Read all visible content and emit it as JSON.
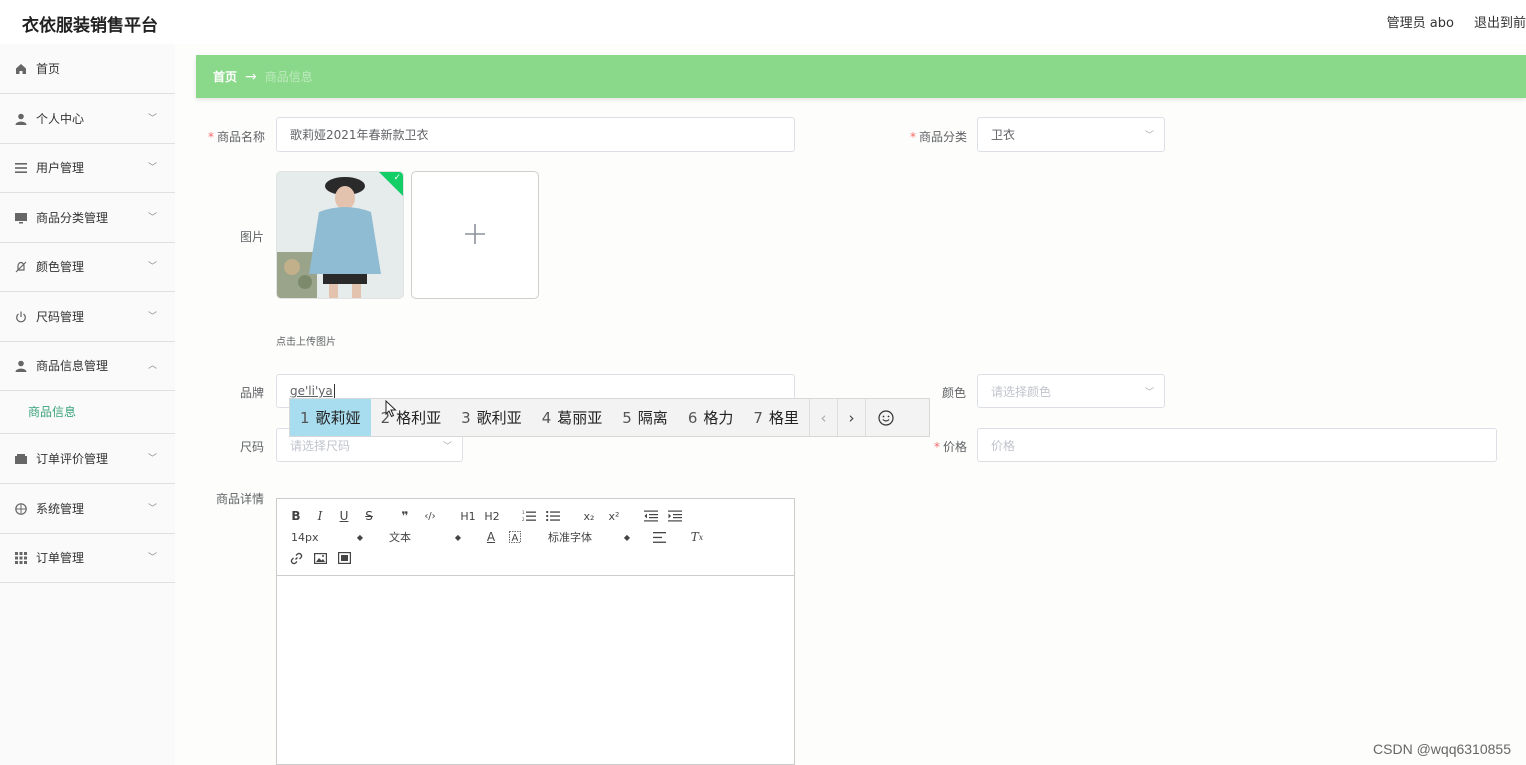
{
  "app": {
    "title": "衣依服装销售平台"
  },
  "header": {
    "user": "管理员 abo",
    "exit": "退出到前"
  },
  "sidebar": {
    "items": [
      {
        "label": "首页",
        "icon": "home-icon"
      },
      {
        "label": "个人中心",
        "icon": "user-icon"
      },
      {
        "label": "用户管理",
        "icon": "list-icon"
      },
      {
        "label": "商品分类管理",
        "icon": "monitor-icon"
      },
      {
        "label": "颜色管理",
        "icon": "bell-off-icon"
      },
      {
        "label": "尺码管理",
        "icon": "power-icon"
      },
      {
        "label": "商品信息管理",
        "icon": "user-icon"
      },
      {
        "label": "订单评价管理",
        "icon": "wallet-icon"
      },
      {
        "label": "系统管理",
        "icon": "globe-icon"
      },
      {
        "label": "订单管理",
        "icon": "grid-icon"
      }
    ],
    "active_sub": "商品信息"
  },
  "breadcrumb": {
    "home": "首页",
    "sep": "→",
    "current": "商品信息"
  },
  "form": {
    "name_label": "商品名称",
    "name_value": "歌莉娅2021年春新款卫衣",
    "category_label": "商品分类",
    "category_value": "卫衣",
    "image_label": "图片",
    "upload_tip": "点击上传图片",
    "brand_label": "品牌",
    "brand_value": "ge'li'ya",
    "color_label": "颜色",
    "color_placeholder": "请选择颜色",
    "size_label": "尺码",
    "size_placeholder": "请选择尺码",
    "price_label": "价格",
    "price_placeholder": "价格",
    "detail_label": "商品详情",
    "required_mark": "*"
  },
  "ime": {
    "candidates": [
      {
        "num": "1",
        "text": "歌莉娅"
      },
      {
        "num": "2",
        "text": "格利亚"
      },
      {
        "num": "3",
        "text": "歌利亚"
      },
      {
        "num": "4",
        "text": "葛丽亚"
      },
      {
        "num": "5",
        "text": "隔离"
      },
      {
        "num": "6",
        "text": "格力"
      },
      {
        "num": "7",
        "text": "格里"
      }
    ],
    "prev": "‹",
    "next": "›"
  },
  "editor": {
    "font_size": "14px",
    "block_type": "文本",
    "font_family": "标准字体",
    "bold": "B",
    "italic": "I",
    "underline": "U",
    "strike": "S",
    "h1": "H1",
    "h2": "H2"
  },
  "watermark": "CSDN @wqq6310855"
}
